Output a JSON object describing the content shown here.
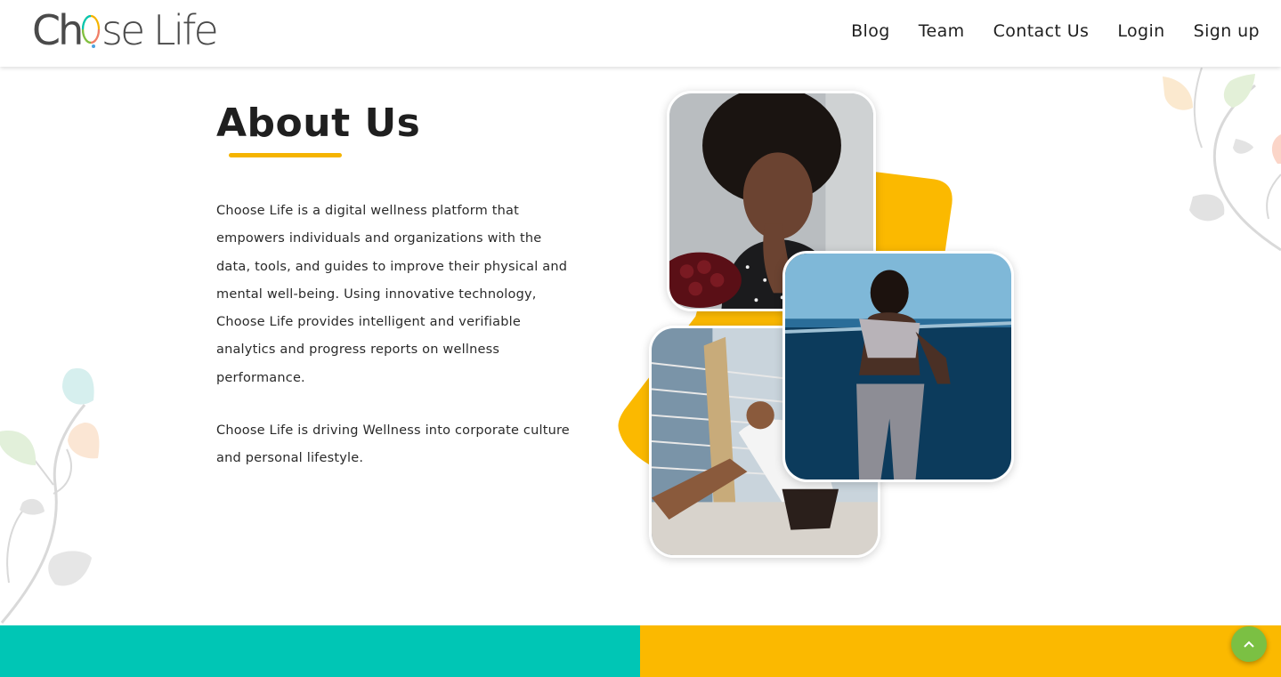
{
  "brand": {
    "name": "Choose Life",
    "colors": {
      "yellow": "#fbb900",
      "teal": "#00c6b5",
      "green": "#7bc043"
    }
  },
  "nav": {
    "items": [
      {
        "label": "Blog"
      },
      {
        "label": "Team"
      },
      {
        "label": "Contact Us"
      },
      {
        "label": "Login"
      },
      {
        "label": "Sign up"
      }
    ]
  },
  "about": {
    "title": "About Us",
    "paragraph1": "Choose Life is a digital wellness platform that empowers individuals and organizations with the data, tools, and guides to improve their physical and mental well-being. Using innovative technology, Choose Life provides intelligent and verifiable analytics and progress reports on wellness performance.",
    "paragraph2": "Choose Life is driving Wellness into corporate culture and personal lifestyle."
  },
  "scroll_top": {
    "icon": "chevron-up-icon"
  }
}
